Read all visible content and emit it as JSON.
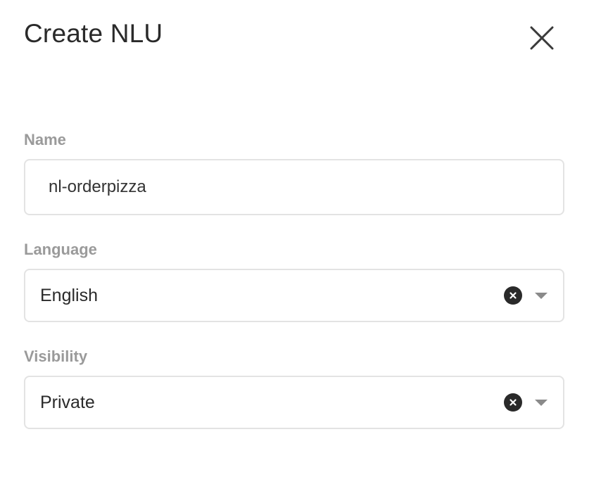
{
  "dialog": {
    "title": "Create NLU",
    "close_icon": "close-icon"
  },
  "form": {
    "name": {
      "label": "Name",
      "value": "nl-orderpizza"
    },
    "language": {
      "label": "Language",
      "selected": "English",
      "clear_icon": "clear-icon",
      "dropdown_icon": "chevron-down-icon"
    },
    "visibility": {
      "label": "Visibility",
      "selected": "Private",
      "clear_icon": "clear-icon",
      "dropdown_icon": "chevron-down-icon"
    }
  }
}
